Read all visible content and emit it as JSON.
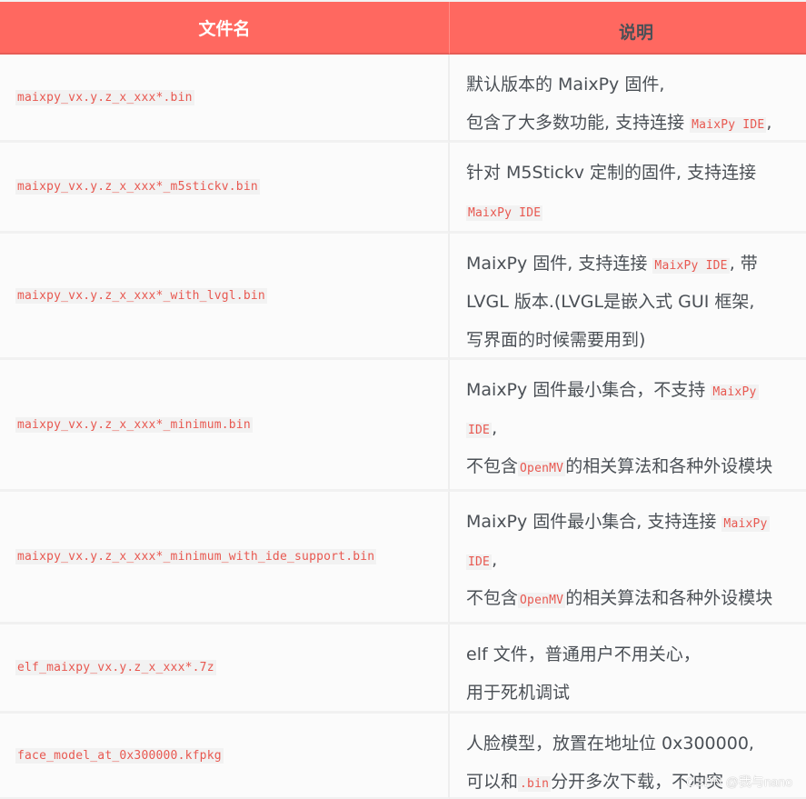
{
  "table": {
    "headers": [
      "文件名",
      "说明"
    ],
    "rows": [
      {
        "file": "maixpy_vx.y.z_x_xxx*.bin",
        "desc": [
          [
            {
              "t": "默认版本的 MaixPy 固件,"
            }
          ],
          [
            {
              "t": "包含了大多数功能, 支持连接 "
            },
            {
              "c": "MaixPy IDE"
            },
            {
              "t": ","
            }
          ]
        ]
      },
      {
        "file": "maixpy_vx.y.z_x_xxx*_m5stickv.bin",
        "desc": [
          [
            {
              "t": "针对 M5Stickv 定制的固件, 支持连接"
            }
          ],
          [
            {
              "c": "MaixPy IDE"
            }
          ]
        ]
      },
      {
        "file": "maixpy_vx.y.z_x_xxx*_with_lvgl.bin",
        "desc": [
          [
            {
              "t": "MaixPy 固件, 支持连接 "
            },
            {
              "c": "MaixPy IDE"
            },
            {
              "t": ", 带"
            }
          ],
          [
            {
              "t": "LVGL 版本.(LVGL是嵌入式 GUI 框架,"
            }
          ],
          [
            {
              "t": "写界面的时候需要用到)"
            }
          ]
        ]
      },
      {
        "file": "maixpy_vx.y.z_x_xxx*_minimum.bin",
        "desc": [
          [
            {
              "t": "MaixPy 固件最小集合，不支持 "
            },
            {
              "c": "MaixPy"
            }
          ],
          [
            {
              "c": "IDE"
            },
            {
              "t": ","
            }
          ],
          [
            {
              "t": "不包含"
            },
            {
              "c": "OpenMV"
            },
            {
              "t": "的相关算法和各种外设模块"
            }
          ]
        ]
      },
      {
        "file": "maixpy_vx.y.z_x_xxx*_minimum_with_ide_support.bin",
        "desc": [
          [
            {
              "t": "MaixPy 固件最小集合, 支持连接 "
            },
            {
              "c": "MaixPy"
            }
          ],
          [
            {
              "c": "IDE"
            },
            {
              "t": ","
            }
          ],
          [
            {
              "t": "不包含"
            },
            {
              "c": "OpenMV"
            },
            {
              "t": "的相关算法和各种外设模块"
            }
          ]
        ]
      },
      {
        "file": "elf_maixpy_vx.y.z_x_xxx*.7z",
        "desc": [
          [
            {
              "t": "elf 文件，普通用户不用关心，"
            }
          ],
          [
            {
              "t": "用于死机调试"
            }
          ]
        ]
      },
      {
        "file": "face_model_at_0x300000.kfpkg",
        "desc": [
          [
            {
              "t": "人脸模型，放置在地址位 0x300000,"
            }
          ],
          [
            {
              "t": "可以和"
            },
            {
              "c": ".bin"
            },
            {
              "t": "分开多次下载，不冲突"
            }
          ]
        ]
      }
    ]
  },
  "watermark": "CSDN @我与nano",
  "colors": {
    "header_bg": "#ff6860",
    "code_text": "#e85850",
    "body_text": "#4b5056",
    "cell_bg": "#fbfbfb"
  }
}
